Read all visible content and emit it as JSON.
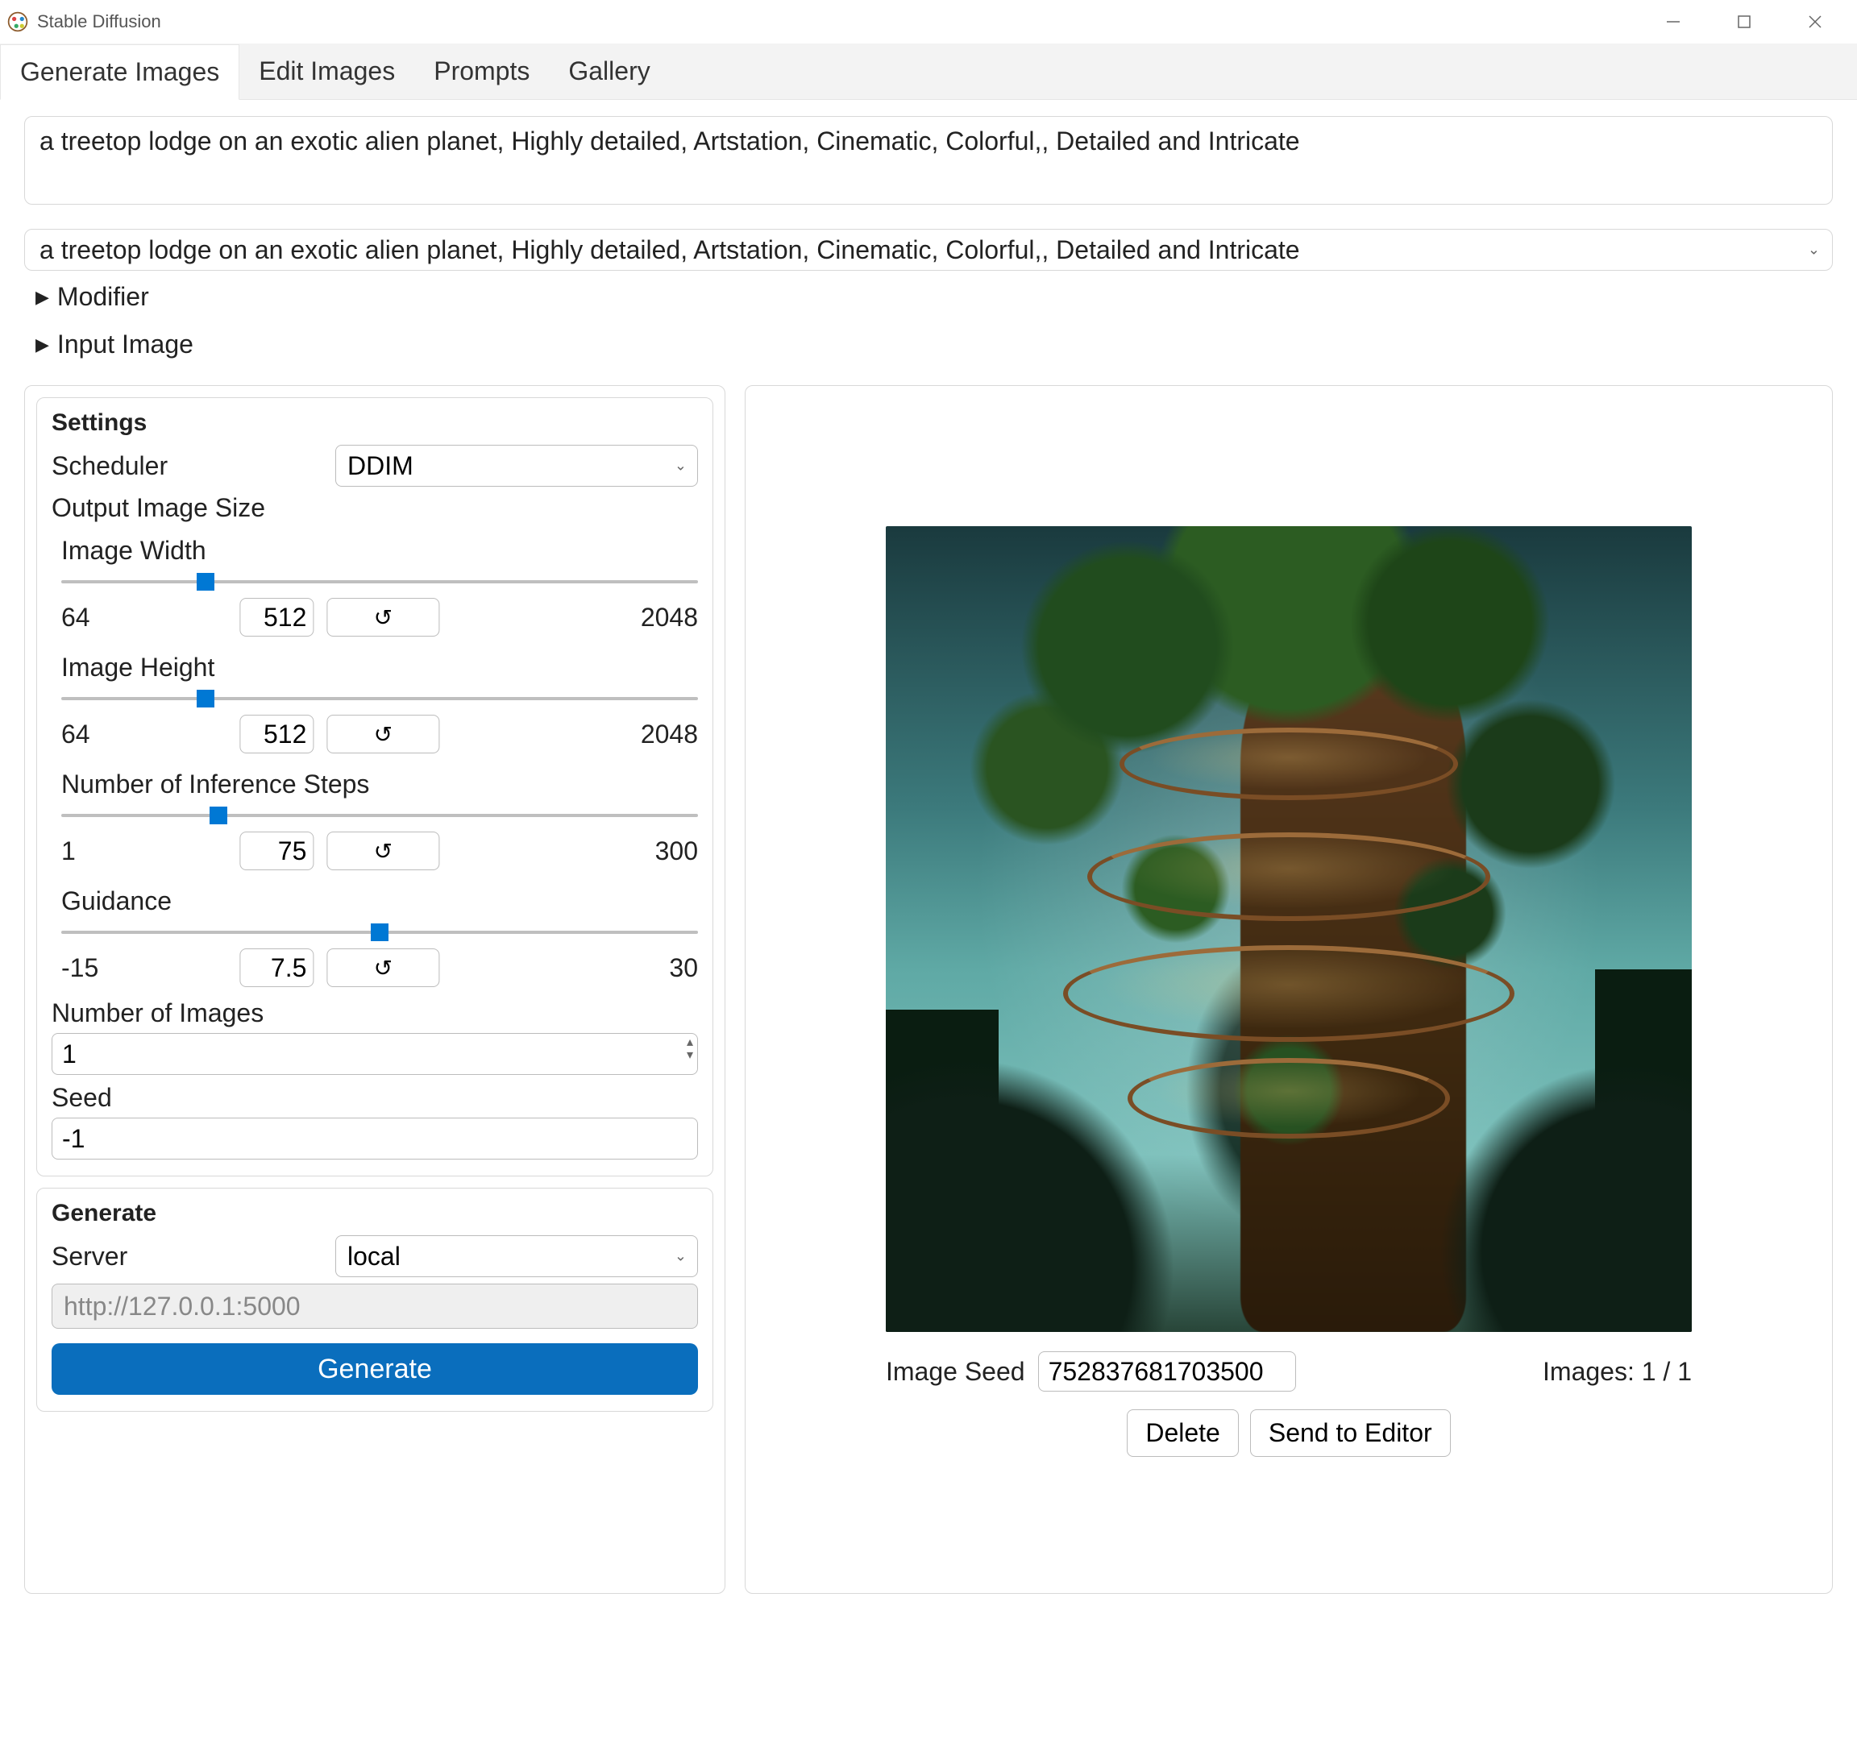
{
  "window": {
    "title": "Stable Diffusion"
  },
  "tabs": [
    {
      "label": "Generate Images",
      "active": true
    },
    {
      "label": "Edit Images",
      "active": false
    },
    {
      "label": "Prompts",
      "active": false
    },
    {
      "label": "Gallery",
      "active": false
    }
  ],
  "prompt": {
    "text": "a treetop lodge on an exotic alien planet, Highly detailed, Artstation, Cinematic, Colorful,, Detailed and Intricate",
    "history_selected": "a treetop lodge on an exotic alien planet, Highly detailed, Artstation, Cinematic, Colorful,, Detailed and Intricate"
  },
  "expanders": {
    "modifier": "Modifier",
    "input_image": "Input Image"
  },
  "settings": {
    "title": "Settings",
    "scheduler_label": "Scheduler",
    "scheduler_value": "DDIM",
    "out_size_label": "Output Image Size",
    "sliders": {
      "width": {
        "label": "Image Width",
        "min": "64",
        "max": "2048",
        "value": "512",
        "thumb_pct": 22.6
      },
      "height": {
        "label": "Image Height",
        "min": "64",
        "max": "2048",
        "value": "512",
        "thumb_pct": 22.6
      },
      "steps": {
        "label": "Number of Inference Steps",
        "min": "1",
        "max": "300",
        "value": "75",
        "thumb_pct": 24.7
      },
      "guidance": {
        "label": "Guidance",
        "min": "-15",
        "max": "30",
        "value": "7.5",
        "thumb_pct": 50.0
      }
    },
    "num_images_label": "Number of Images",
    "num_images_value": "1",
    "seed_label": "Seed",
    "seed_value": "-1"
  },
  "generate": {
    "title": "Generate",
    "server_label": "Server",
    "server_value": "local",
    "url": "http://127.0.0.1:5000",
    "button": "Generate"
  },
  "output": {
    "image_seed_label": "Image Seed",
    "image_seed_value": "752837681703500",
    "images_count": "Images: 1 / 1",
    "delete": "Delete",
    "send_to_editor": "Send to Editor"
  },
  "reset_glyph": "↺"
}
